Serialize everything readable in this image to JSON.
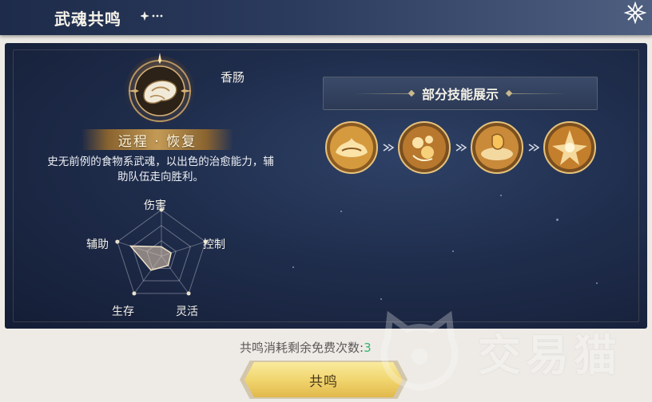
{
  "header": {
    "title": "武魂共鸣",
    "decoration": "✦···"
  },
  "soul": {
    "name": "香肠",
    "tags": "远程 · 恢复",
    "description": "史无前例的食物系武魂，以出色的治愈能力，辅助队伍走向胜利。"
  },
  "radar": {
    "axes": [
      "伤害",
      "控制",
      "灵活",
      "生存",
      "辅助"
    ],
    "values": [
      0.2,
      0.22,
      0.25,
      0.38,
      0.7
    ]
  },
  "skills": {
    "title": "部分技能展示",
    "icons": [
      "skill-icon-1",
      "skill-icon-2",
      "skill-icon-3",
      "skill-icon-4"
    ]
  },
  "footer": {
    "remaining_label": "共鸣消耗剩余免费次数:",
    "remaining_count": "3",
    "button_label": "共鸣"
  },
  "watermark": {
    "text": "交易猫"
  },
  "colors": {
    "accent_gold": "#f0d36b",
    "panel_bg": "#1f2d4c",
    "count_green": "#36b36b"
  }
}
